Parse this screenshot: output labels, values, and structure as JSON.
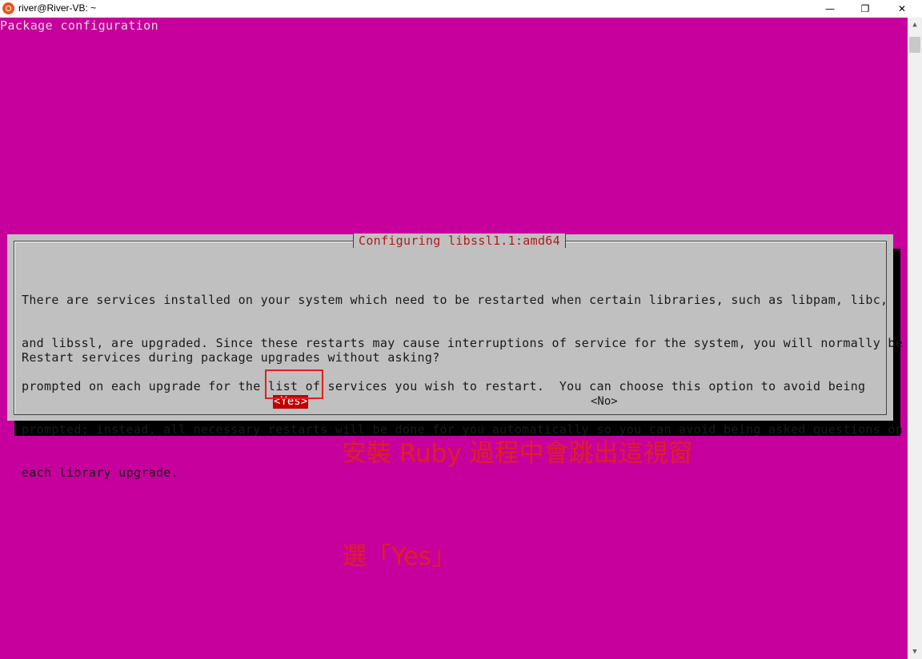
{
  "window": {
    "title": "river@River-VB: ~",
    "minimize_glyph": "—",
    "maximize_glyph": "❐",
    "close_glyph": "✕"
  },
  "terminal": {
    "header": "Package configuration"
  },
  "dialog": {
    "title": "Configuring libssl1.1:amd64",
    "body_lines": [
      "There are services installed on your system which need to be restarted when certain libraries, such as libpam, libc,",
      "and libssl, are upgraded. Since these restarts may cause interruptions of service for the system, you will normally be",
      "prompted on each upgrade for the list of services you wish to restart.  You can choose this option to avoid being",
      "prompted; instead, all necessary restarts will be done for you automatically so you can avoid being asked questions on",
      "each library upgrade."
    ],
    "question": "Restart services during package upgrades without asking?",
    "yes_label": "<Yes>",
    "no_label": "<No>"
  },
  "annotation": {
    "line1": "安裝 Ruby 過程中會跳出這視窗",
    "line2": "選「Yes」"
  },
  "colors": {
    "terminal_bg": "#c7009d",
    "dialog_bg": "#c0c0c0",
    "selected_button": "#c00000",
    "annotation": "#e02020"
  }
}
